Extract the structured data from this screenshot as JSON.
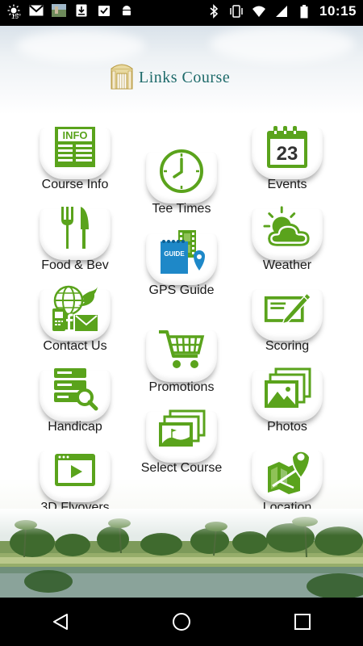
{
  "status_bar": {
    "temperature": "15°",
    "time": "10:15"
  },
  "app": {
    "title": "Links Course",
    "accent_color": "#5aa31c",
    "menu": [
      {
        "label": "Course Info",
        "icon": "info-newspaper-icon"
      },
      {
        "label": "Tee Times",
        "icon": "clock-icon"
      },
      {
        "label": "Events",
        "icon": "calendar-icon"
      },
      {
        "label": "Food & Bev",
        "icon": "fork-knife-icon"
      },
      {
        "label": "GPS Guide",
        "icon": "gps-guide-icon"
      },
      {
        "label": "Weather",
        "icon": "weather-sun-cloud-icon"
      },
      {
        "label": "Contact Us",
        "icon": "contact-social-icon"
      },
      {
        "label": "Promotions",
        "icon": "shopping-cart-icon"
      },
      {
        "label": "Scoring",
        "icon": "scorecard-pencil-icon"
      },
      {
        "label": "Handicap",
        "icon": "database-search-icon"
      },
      {
        "label": "Select Course",
        "icon": "photo-stack-icon"
      },
      {
        "label": "Photos",
        "icon": "photos-icon"
      },
      {
        "label": "3D Flyovers",
        "icon": "video-play-icon"
      },
      {
        "label": "Location",
        "icon": "map-pin-icon"
      }
    ],
    "calendar_day": "23",
    "guide_badge": "GUIDE",
    "info_badge": "INFO"
  }
}
